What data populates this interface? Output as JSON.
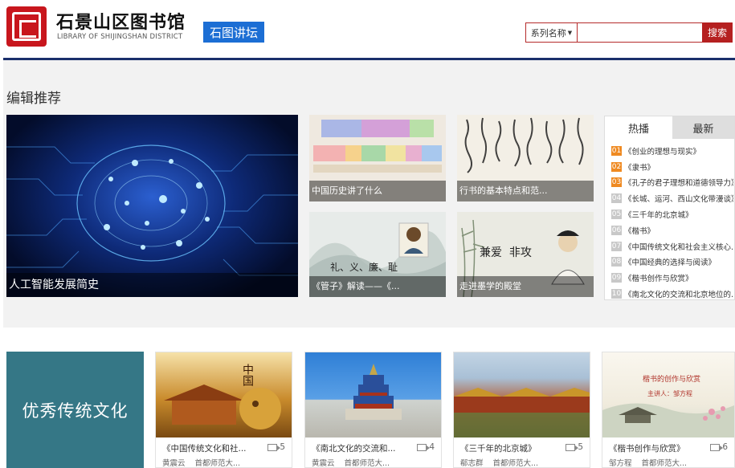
{
  "header": {
    "library_name": "石景山区图书馆",
    "library_name_en": "LIBRARY OF SHIJINGSHAN DISTRICT",
    "channel_tag": "石图讲坛",
    "search": {
      "select_value": "系列名称",
      "input_value": "",
      "button_label": "搜索"
    }
  },
  "editor_picks": {
    "title": "编辑推荐",
    "tiles": [
      {
        "caption": "人工智能发展简史"
      },
      {
        "caption": "中国历史讲了什么"
      },
      {
        "caption": "行书的基本特点和范..."
      },
      {
        "caption": "《管子》解读——《..."
      },
      {
        "caption": "走进墨学的殿堂"
      }
    ],
    "tile_inner_text": {
      "guanzi": "礼、义、廉、耻",
      "mozi": "兼爱  非攻"
    }
  },
  "hot_panel": {
    "tabs": [
      "热播",
      "最新"
    ],
    "items": [
      {
        "rank": "01",
        "title": "《创业的理想与现实》"
      },
      {
        "rank": "02",
        "title": "《隶书》"
      },
      {
        "rank": "03",
        "title": "《孔子的君子理想和道德领导力》"
      },
      {
        "rank": "04",
        "title": "《长城、运河、西山文化带漫谈》"
      },
      {
        "rank": "05",
        "title": "《三千年的北京城》"
      },
      {
        "rank": "06",
        "title": "《楷书》"
      },
      {
        "rank": "07",
        "title": "《中国传统文化和社会主义核心..."
      },
      {
        "rank": "08",
        "title": "《中国经典的选择与阅读》"
      },
      {
        "rank": "09",
        "title": "《楷书创作与欣赏》"
      },
      {
        "rank": "10",
        "title": "《南北文化的交流和北京地位的..."
      }
    ]
  },
  "traditional": {
    "feature_label": "优秀传统文化",
    "cards": [
      {
        "title": "《中国传统文化和社...",
        "count": "5",
        "author": "黄震云",
        "org": "首都师范大..."
      },
      {
        "title": "《南北文化的交流和...",
        "count": "4",
        "author": "黄震云",
        "org": "首都师范大..."
      },
      {
        "title": "《三千年的北京城》",
        "count": "5",
        "author": "郗志群",
        "org": "首都师范大..."
      },
      {
        "title": "《楷书创作与欣赏》",
        "count": "6",
        "author": "邹方程",
        "org": "首都师范大..."
      }
    ],
    "card_inner_text": {
      "c1_overlay": "中国",
      "c4_overlay": "楷书的创作与欣赏",
      "c4_speaker": "主讲人：邹方程"
    }
  },
  "colors": {
    "brand_red": "#c8161d",
    "channel_blue": "#1c6ed4",
    "header_rule": "#1a2f6b",
    "feature_teal": "#357786",
    "rank_top": "#ef8a22"
  }
}
